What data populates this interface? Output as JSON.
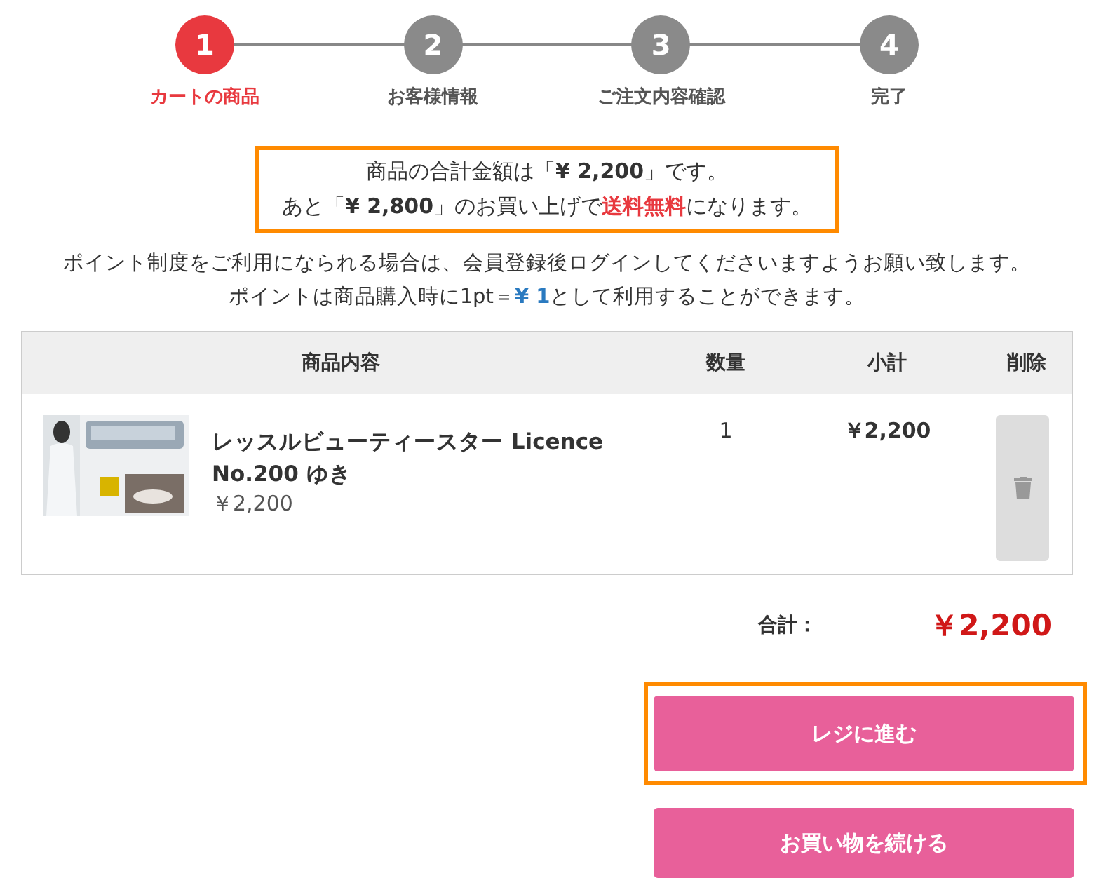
{
  "steps": [
    {
      "number": "1",
      "label": "カートの商品",
      "selected": true
    },
    {
      "number": "2",
      "label": "お客様情報",
      "selected": false
    },
    {
      "number": "3",
      "label": "ご注文内容確認",
      "selected": false
    },
    {
      "number": "4",
      "label": "完了",
      "selected": false
    }
  ],
  "notice": {
    "highlighted": true,
    "lines": [
      [
        {
          "kind": "plain",
          "text": "商品の合計金額は「"
        },
        {
          "kind": "bold",
          "text": "¥ 2,200"
        },
        {
          "kind": "plain",
          "text": "」です。"
        }
      ],
      [
        {
          "kind": "plain",
          "text": "あと「"
        },
        {
          "kind": "bold",
          "text": "¥ 2,800"
        },
        {
          "kind": "plain",
          "text": "」のお買い上げで"
        },
        {
          "kind": "alert",
          "text": "送料無料"
        },
        {
          "kind": "plain",
          "text": "になります。"
        }
      ]
    ]
  },
  "point_info": [
    [
      {
        "kind": "plain",
        "text": "ポイント制度をご利用になられる場合は、会員登録後ログインしてくださいますようお願い致します。"
      }
    ],
    [
      {
        "kind": "plain",
        "text": "ポイントは商品購入時に1pt＝"
      },
      {
        "kind": "accent",
        "text": "¥ 1"
      },
      {
        "kind": "plain",
        "text": "として利用することができます。"
      }
    ]
  ],
  "table": {
    "columns": [
      "商品内容",
      "数量",
      "小計",
      "削除"
    ],
    "rows": [
      {
        "name": "レッスルビューティースター Licence No.200 ゆき",
        "price": "￥2,200",
        "quantity": "1",
        "subtotal": "￥2,200"
      }
    ]
  },
  "total": {
    "label": "合計：",
    "value": "￥2,200"
  },
  "buttons": [
    {
      "label": "レジに進む",
      "highlighted": true
    },
    {
      "label": "お買い物を続ける",
      "highlighted": false
    }
  ]
}
